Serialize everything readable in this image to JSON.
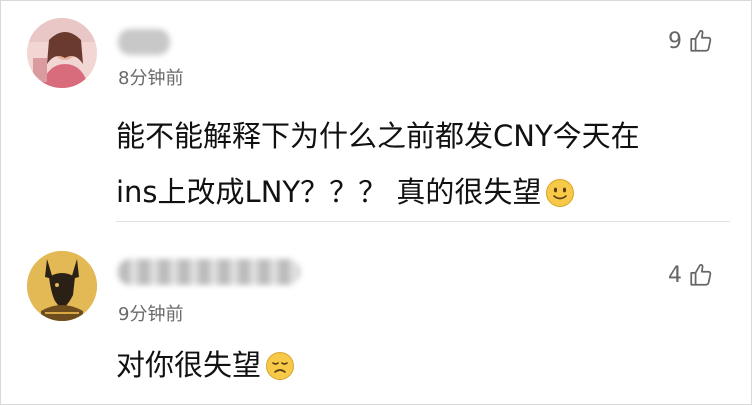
{
  "comments": [
    {
      "time": "8分钟前",
      "likes": "9",
      "line1": "能不能解释下为什么之前都发CNY今天在",
      "line2": "ins上改成LNY？？？ 真的很失望",
      "emoji": "smile-emoji"
    },
    {
      "time": "9分钟前",
      "likes": "4",
      "line1": "对你很失望",
      "emoji": "sad-emoji"
    }
  ],
  "icons": {
    "like": "thumbs-up-outline-icon"
  },
  "colors": {
    "text": "#111111",
    "meta": "#6a6a6a",
    "emoji": "#f7c948",
    "divider": "#e2e2e2"
  }
}
